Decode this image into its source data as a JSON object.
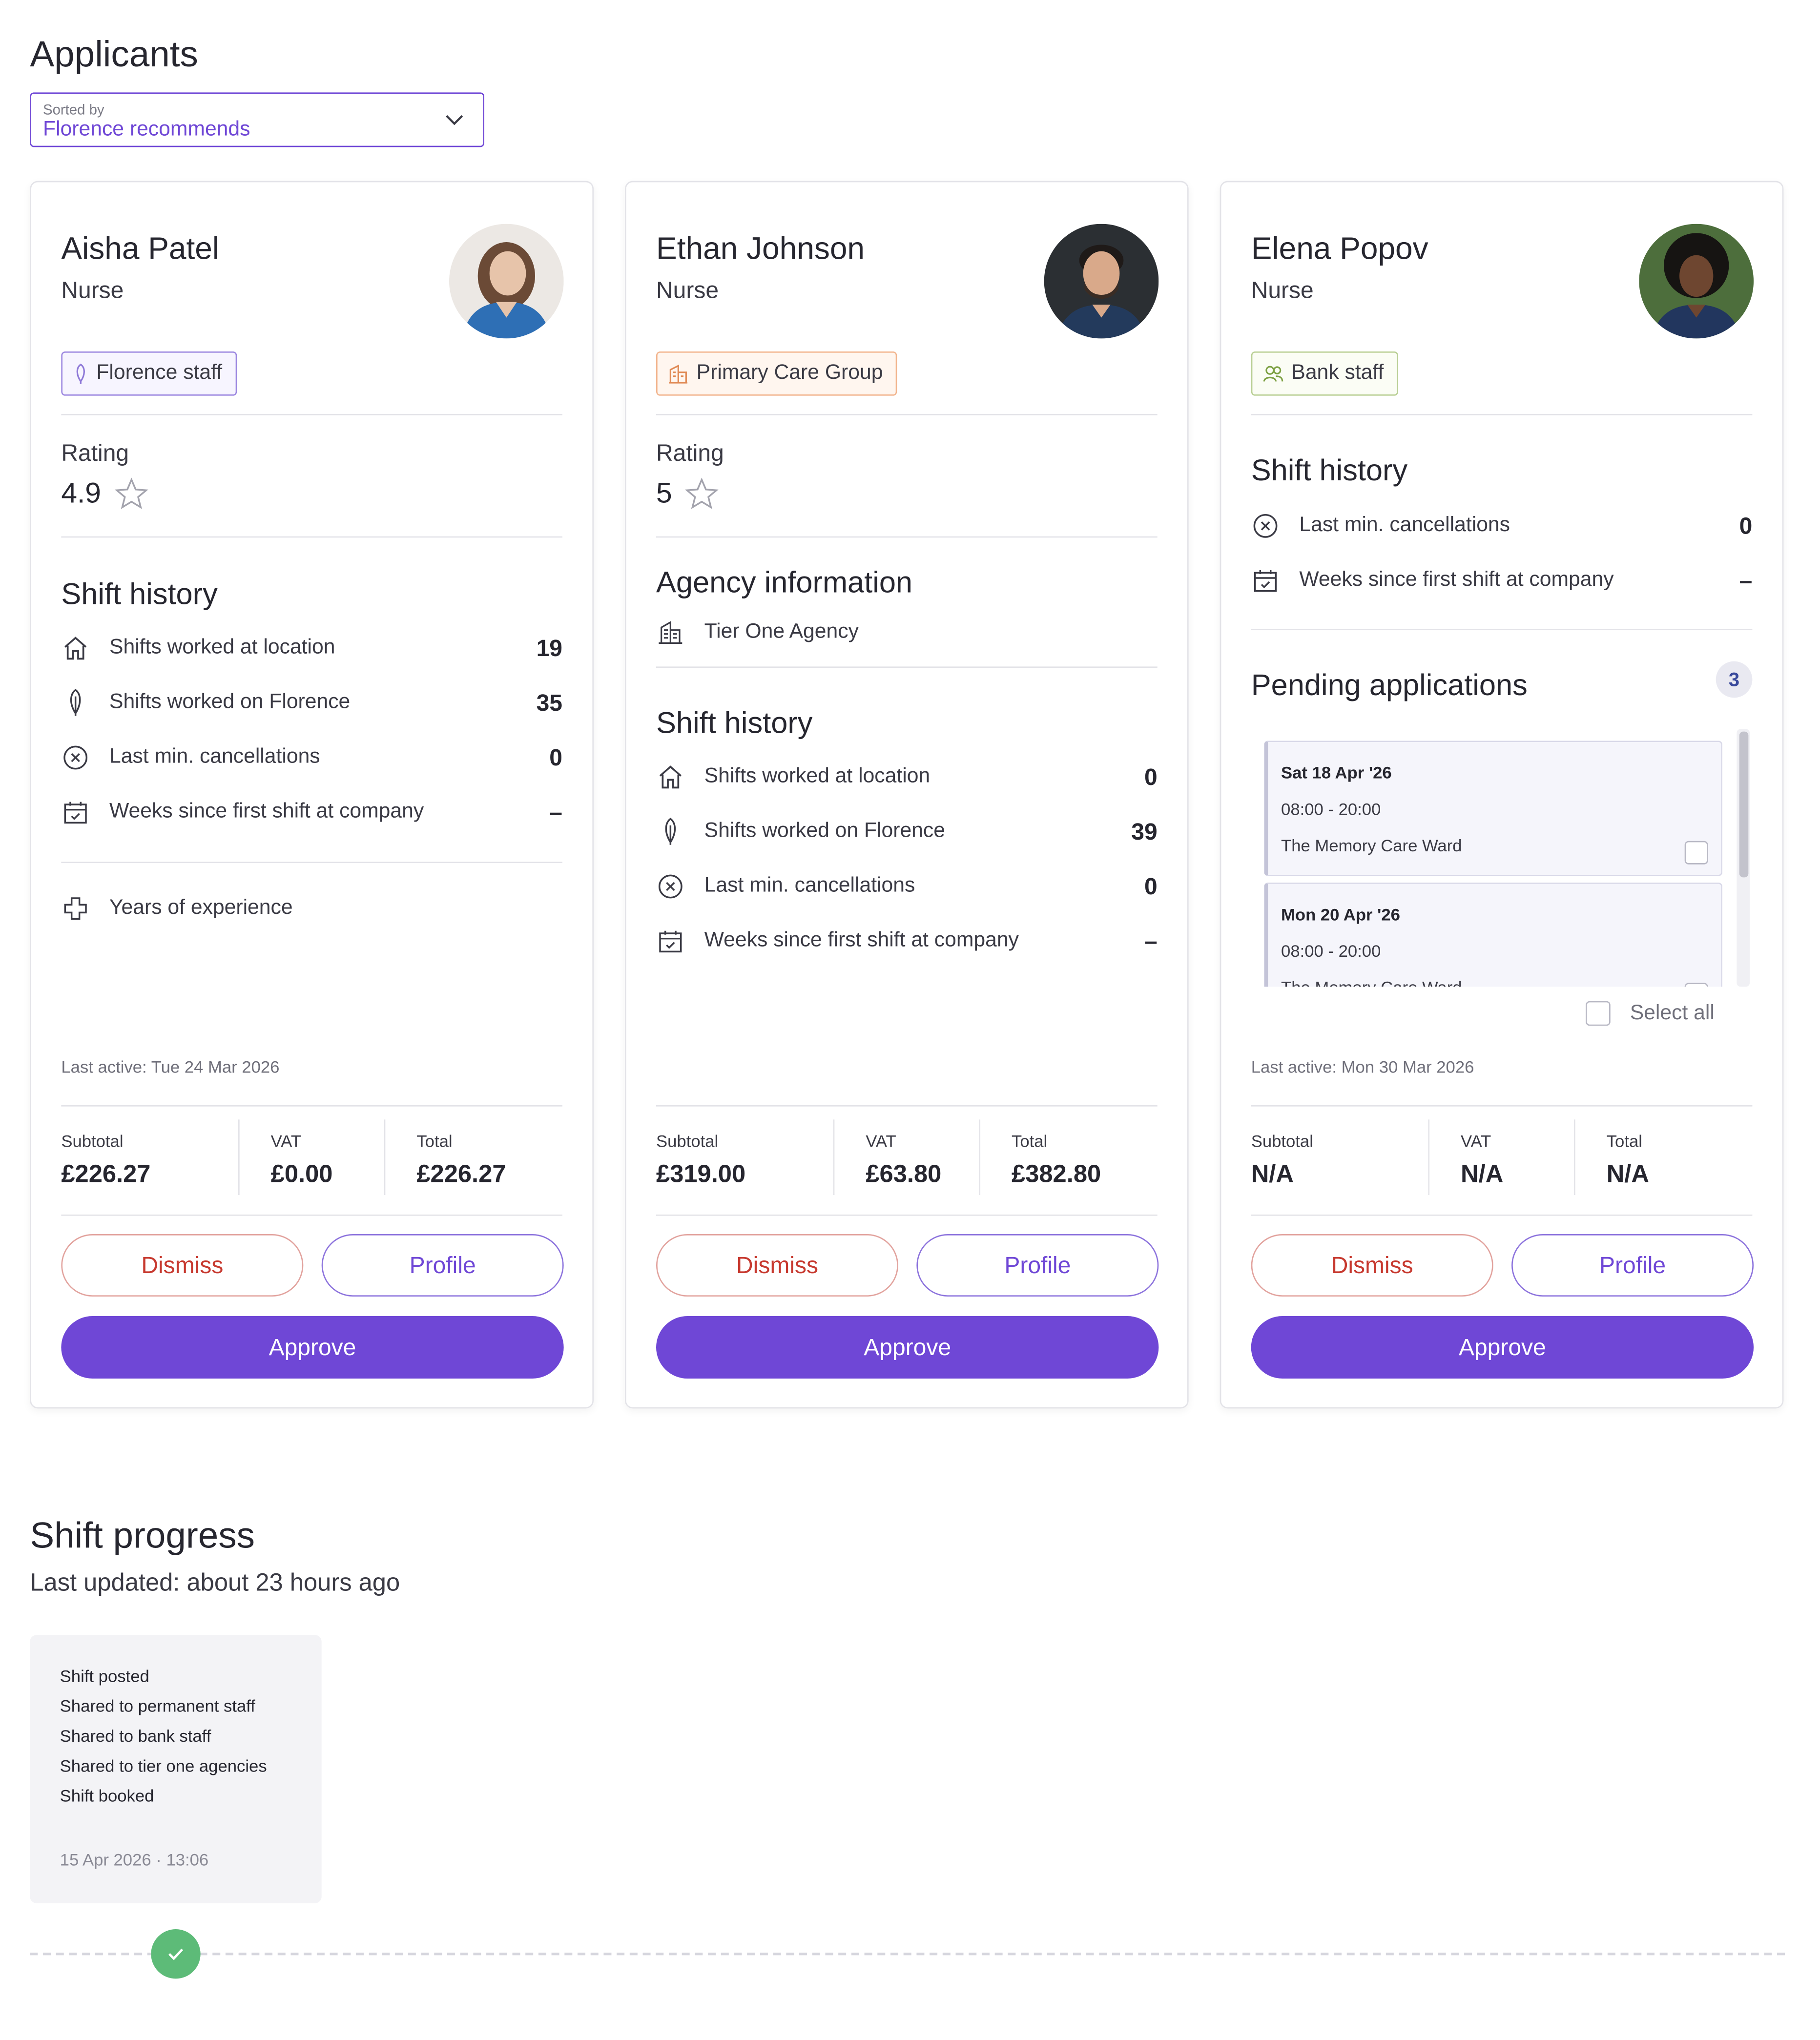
{
  "page": {
    "title": "Applicants"
  },
  "sort": {
    "label": "Sorted by",
    "value": "Florence recommends"
  },
  "labels": {
    "rating": "Rating",
    "shift_history": "Shift history",
    "agency_information": "Agency information",
    "pending_applications": "Pending applications",
    "shifts_location": "Shifts worked at location",
    "shifts_florence": "Shifts worked on Florence",
    "cancellations": "Last min. cancellations",
    "weeks_since": "Weeks since first shift at company",
    "years_experience": "Years of experience",
    "subtotal": "Subtotal",
    "vat": "VAT",
    "total": "Total",
    "dismiss": "Dismiss",
    "profile": "Profile",
    "approve": "Approve",
    "select_all": "Select all"
  },
  "applicants": [
    {
      "name": "Aisha Patel",
      "role": "Nurse",
      "badge": "Florence staff",
      "rating": "4.9",
      "shifts_location": "19",
      "shifts_florence": "35",
      "cancellations": "0",
      "weeks_since": "–",
      "last_active": "Last active: Tue 24 Mar 2026",
      "subtotal": "£226.27",
      "vat": "£0.00",
      "total": "£226.27"
    },
    {
      "name": "Ethan Johnson",
      "role": "Nurse",
      "badge": "Primary Care Group",
      "rating": "5",
      "agency": "Tier One Agency",
      "shifts_location": "0",
      "shifts_florence": "39",
      "cancellations": "0",
      "weeks_since": "–",
      "subtotal": "£319.00",
      "vat": "£63.80",
      "total": "£382.80"
    },
    {
      "name": "Elena Popov",
      "role": "Nurse",
      "badge": "Bank staff",
      "cancellations": "0",
      "weeks_since": "–",
      "pending_count": "3",
      "pending": [
        {
          "date": "Sat 18 Apr '26",
          "time": "08:00 - 20:00",
          "ward": "The Memory Care Ward"
        },
        {
          "date": "Mon 20 Apr '26",
          "time": "08:00 - 20:00",
          "ward": "The Memory Care Ward"
        }
      ],
      "last_active": "Last active: Mon 30 Mar 2026",
      "subtotal": "N/A",
      "vat": "N/A",
      "total": "N/A"
    }
  ],
  "progress": {
    "title": "Shift progress",
    "updated": "Last updated: about 23 hours ago",
    "events": [
      "Shift posted",
      "Shared to permanent staff",
      "Shared to bank staff",
      "Shared to tier one agencies",
      "Shift booked"
    ],
    "timestamp": "15 Apr 2026 · 13:06"
  },
  "colors": {
    "accent": "#6f47d6",
    "dismiss": "#c7392f",
    "success": "#5dbb78"
  },
  "icons": [
    "chevron-down-icon",
    "star-icon",
    "home-icon",
    "feather-icon",
    "cancel-circle-icon",
    "calendar-check-icon",
    "medical-cross-icon",
    "building-icon",
    "people-icon",
    "check-icon"
  ]
}
